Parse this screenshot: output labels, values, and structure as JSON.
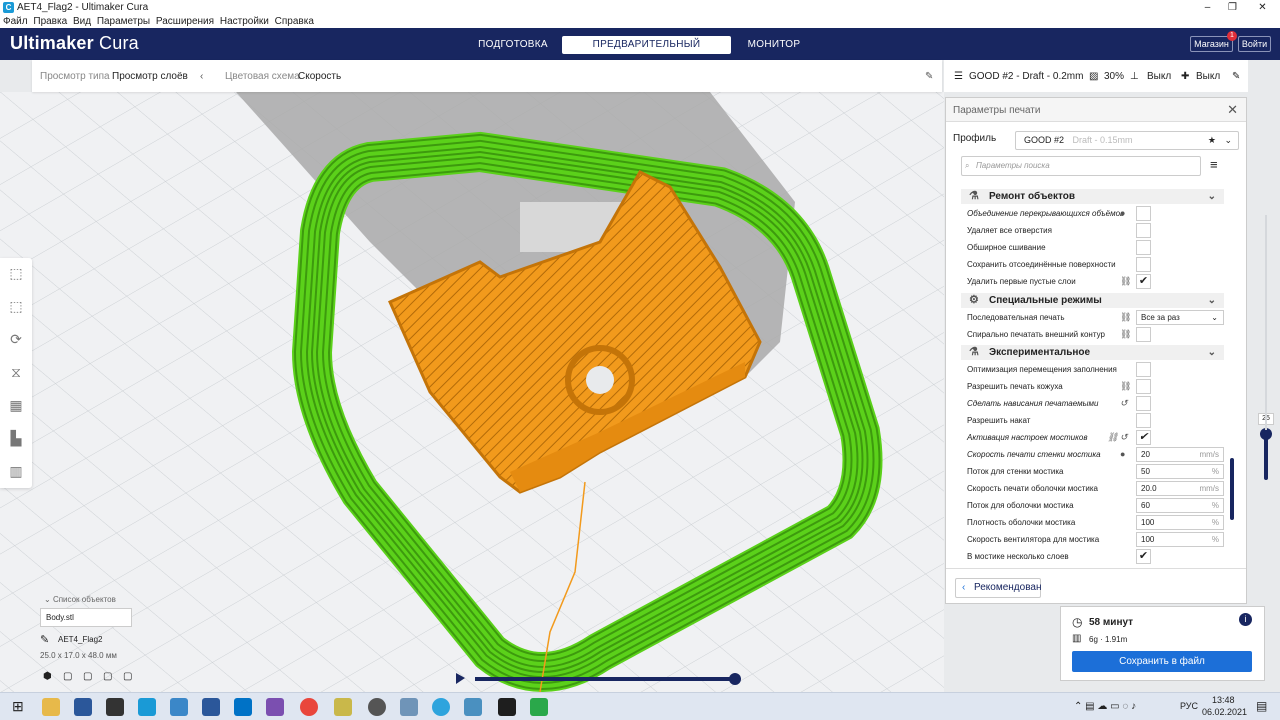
{
  "window": {
    "title": "AET4_Flag2 - Ultimaker Cura",
    "app_icon": "cura-icon"
  },
  "menu": [
    "Файл",
    "Правка",
    "Вид",
    "Параметры",
    "Расширения",
    "Настройки",
    "Справка"
  ],
  "header": {
    "logo_main": "Ultimaker",
    "logo_sub": "Cura",
    "stages": [
      "ПОДГОТОВКА",
      "ПРЕДВАРИТЕЛЬНЫЙ ПРОСМОТР",
      "МОНИТОР"
    ],
    "active_stage": "ПРЕДВАРИТЕЛЬНЫЙ ПРОСМОТР",
    "store_label": "Магазин",
    "store_badge": "1",
    "login_label": "Войти",
    "accent": "#182660"
  },
  "view_bar": {
    "view_type_label": "Просмотр типа",
    "view_type_value": "Просмотр слоёв",
    "color_scheme_label": "Цветовая схема",
    "color_scheme_value": "Скорость"
  },
  "print_bar": {
    "profile": "GOOD #2 - Draft - 0.2mm",
    "infill": "30%",
    "support": "Выкл",
    "adhesion": "Выкл"
  },
  "print_settings": {
    "title": "Параметры печати",
    "profile_label": "Профиль",
    "profile_value": "GOOD #2",
    "profile_suffix": "Draft - 0.15mm",
    "search_placeholder": "Параметры поиска",
    "categories": [
      {
        "name": "Ремонт объектов",
        "settings": [
          {
            "label": "Объединение перекрывающихся объёмов",
            "italic": true,
            "icon": "info",
            "checked": false
          },
          {
            "label": "Удаляет все отверстия",
            "checked": false
          },
          {
            "label": "Обширное сшивание",
            "checked": false
          },
          {
            "label": "Сохранить отсоединённые поверхности",
            "checked": false
          },
          {
            "label": "Удалить первые пустые слои",
            "icon": "link",
            "checked": true
          }
        ]
      },
      {
        "name": "Специальные режимы",
        "settings": [
          {
            "label": "Последовательная печать",
            "icon": "link",
            "select": "Все за раз"
          },
          {
            "label": "Спирально печатать внешний контур",
            "icon": "link",
            "checked": false
          }
        ]
      },
      {
        "name": "Экспериментальное",
        "settings": [
          {
            "label": "Оптимизация перемещения заполнения",
            "checked": false
          },
          {
            "label": "Разрешить печать кожуха",
            "icon": "link",
            "checked": false
          },
          {
            "label": "Сделать нависания печатаемыми",
            "italic": true,
            "icon": "reset",
            "checked": false
          },
          {
            "label": "Разрешить накат",
            "checked": false
          },
          {
            "label": "Активация настроек мостиков",
            "italic": true,
            "icon": "link-reset",
            "checked": true
          },
          {
            "label": "Скорость печати стенки мостика",
            "italic": true,
            "icon": "info",
            "value": "20",
            "unit": "mm/s"
          },
          {
            "label": "Поток для стенки мостика",
            "value": "50",
            "unit": "%"
          },
          {
            "label": "Скорость печати оболочки мостика",
            "value": "20.0",
            "unit": "mm/s"
          },
          {
            "label": "Поток для оболочки мостика",
            "value": "60",
            "unit": "%"
          },
          {
            "label": "Плотность оболочки мостика",
            "value": "100",
            "unit": "%"
          },
          {
            "label": "Скорость вентилятора для мостика",
            "value": "100",
            "unit": "%"
          },
          {
            "label": "В мостике несколько слоев",
            "checked": true
          }
        ]
      }
    ],
    "recommended_label": "Рекомендован"
  },
  "estimate": {
    "time": "58 минут",
    "material": "6g · 1.91m",
    "save_label": "Сохранить в файл"
  },
  "layer_slider": {
    "value": "25"
  },
  "object_list": {
    "title": "Список объектов",
    "file": "Body.stl",
    "job_name": "AET4_Flag2",
    "dims": "25.0 x 17.0 x 48.0 мм"
  },
  "taskbar": {
    "lang": "РУС",
    "time": "13:48",
    "date": "06.02.2021"
  },
  "colors": {
    "skirt": "#5bd11a",
    "model": "#f29a1c",
    "save": "#1c6fd8"
  }
}
